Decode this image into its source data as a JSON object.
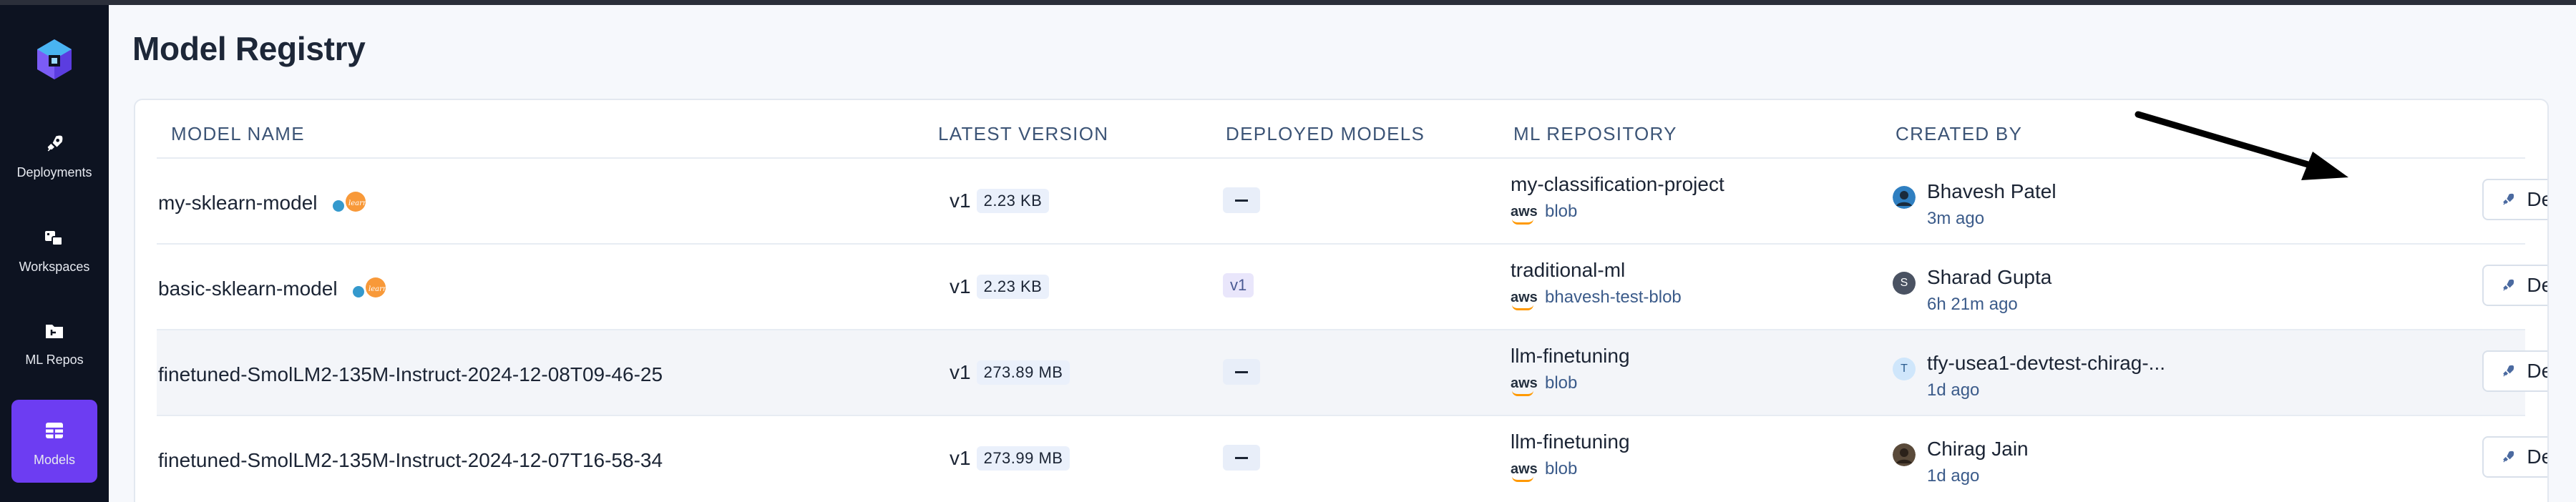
{
  "app": {
    "page_title": "Model Registry"
  },
  "sidebar": {
    "items": [
      {
        "label": "Deployments",
        "icon": "rocket-icon",
        "active": false
      },
      {
        "label": "Workspaces",
        "icon": "workspaces-icon",
        "active": false
      },
      {
        "label": "ML Repos",
        "icon": "ml-repo-icon",
        "active": false
      },
      {
        "label": "Models",
        "icon": "models-table-icon",
        "active": true
      }
    ]
  },
  "table": {
    "columns": [
      "MODEL NAME",
      "LATEST VERSION",
      "DEPLOYED MODELS",
      "ML REPOSITORY",
      "CREATED BY"
    ],
    "rows": [
      {
        "name": "my-sklearn-model",
        "version": "v1",
        "size": "2.23 KB",
        "deployed": "",
        "repo": "my-classification-project",
        "storage": "aws",
        "bucket": "blob",
        "creator": "Bhavesh Patel",
        "created": "3m ago",
        "avatar_initial": "",
        "action": "Deploy"
      },
      {
        "name": "basic-sklearn-model",
        "version": "v1",
        "size": "2.23 KB",
        "deployed": "v1",
        "repo": "traditional-ml",
        "storage": "aws",
        "bucket": "bhavesh-test-blob",
        "creator": "Sharad Gupta",
        "created": "6h 21m ago",
        "avatar_initial": "S",
        "action": "Deploy"
      },
      {
        "name": "finetuned-SmolLM2-135M-Instruct-2024-12-08T09-46-25",
        "version": "v1",
        "size": "273.89 MB",
        "deployed": "",
        "repo": "llm-finetuning",
        "storage": "aws",
        "bucket": "blob",
        "creator": "tfy-usea1-devtest-chirag-...",
        "created": "1d ago",
        "avatar_initial": "T",
        "action": "Deploy"
      },
      {
        "name": "finetuned-SmolLM2-135M-Instruct-2024-12-07T16-58-34",
        "version": "v1",
        "size": "273.99 MB",
        "deployed": "",
        "repo": "llm-finetuning",
        "storage": "aws",
        "bucket": "blob",
        "creator": "Chirag Jain",
        "created": "1d ago",
        "avatar_initial": "",
        "action": "Deploy"
      }
    ]
  },
  "colors": {
    "sidebar_bg": "#0d1321",
    "active_nav": "#6d3df2",
    "header_text": "#3c5476",
    "link_text": "#3b5b8a"
  }
}
